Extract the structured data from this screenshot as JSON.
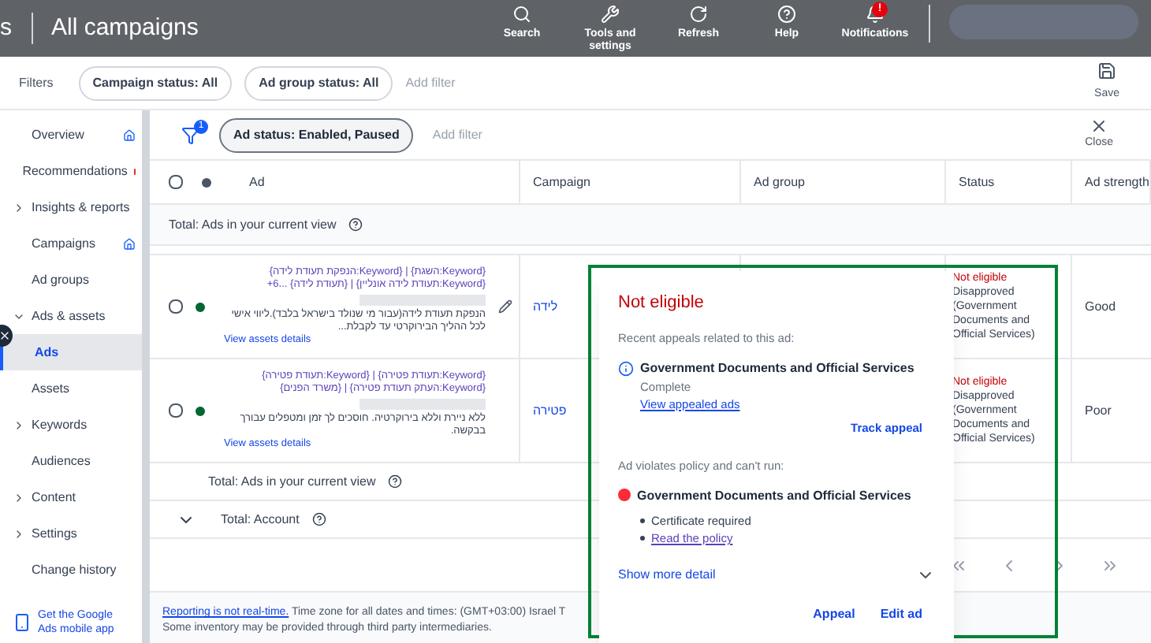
{
  "header": {
    "title_fragment": "s",
    "title": "All campaigns",
    "actions": [
      {
        "kind": "search",
        "label": "Search"
      },
      {
        "kind": "tools",
        "label": "Tools and settings"
      },
      {
        "kind": "refresh",
        "label": "Refresh"
      },
      {
        "kind": "help",
        "label": "Help"
      },
      {
        "kind": "notifications",
        "label": "Notifications",
        "badge": "!"
      }
    ]
  },
  "filters": {
    "label": "Filters",
    "chips": [
      "Campaign status: All",
      "Ad group status: All"
    ],
    "add_filter": "Add filter",
    "save": "Save"
  },
  "sidebar": {
    "items": [
      {
        "label": "Overview",
        "icon": true,
        "selected": false
      },
      {
        "label": "Recommendations",
        "color": "#d93025",
        "selected": false
      },
      {
        "label": "Insights & reports",
        "expanded": false,
        "selected": false
      },
      {
        "label": "Campaigns",
        "icon": true,
        "selected": false
      },
      {
        "label": "Ad groups",
        "selected": false
      },
      {
        "label": "Ads & assets",
        "expanded": true,
        "selected": false,
        "children": [
          {
            "label": "Ads",
            "selected": true
          },
          {
            "label": "Assets",
            "selected": false
          }
        ]
      },
      {
        "label": "Keywords",
        "expanded": false,
        "selected": false
      },
      {
        "label": "Audiences",
        "selected": false
      },
      {
        "label": "Content",
        "expanded": false,
        "selected": false
      },
      {
        "label": "Settings",
        "expanded": false,
        "selected": false
      },
      {
        "label": "Change history",
        "selected": false
      }
    ],
    "app_promo": "Get the Google Ads mobile app"
  },
  "table_filters": {
    "badge": "1",
    "chip": "Ad status: Enabled, Paused",
    "add_filter": "Add filter",
    "close": "Close"
  },
  "table": {
    "select_all_checked": false,
    "columns": [
      "Ad",
      "Campaign",
      "Ad group",
      "Status",
      "Ad strength"
    ],
    "total_top": "Total: Ads in your current view",
    "rows": [
      {
        "headline": "{Keyword:השגת} | {Keyword:הנפקת תעודת לידה} {Keyword:תעודת לידה אונליין} | {תעודת לידה} ...6+",
        "description": "הנפקת תעודת לידה(עבור מי שנולד בישראל בלבד).ליווי אישי לכל ההליך הבירוקרטי עד לקבלת...",
        "link": "View assets details",
        "campaign": "לידה",
        "status": "Not eligible",
        "status_detail": "Disapproved (Government Documents and Official Services)",
        "strength": "Good",
        "editable": true,
        "checked": false
      },
      {
        "headline": "{Keyword:תעודת פטירה} | {Keyword:תעודת פטירה} {Keyword:העתק תעודת פטירה} | {משרד הפנים}",
        "description": "ללא ניירת וללא בירוקרטיה. חוסכים לך זמן ומטפלים עבורך בבקשה.",
        "link": "View assets details",
        "campaign": "פטירה",
        "status": "Not eligible",
        "status_detail": "Disapproved (Government Documents and Official Services)",
        "strength": "Poor",
        "editable": false,
        "checked": false
      }
    ],
    "totals": [
      "Total: Ads in your current view",
      "Total: Account"
    ]
  },
  "popup": {
    "title": "Not eligible",
    "appeals_label": "Recent appeals related to this ad:",
    "appeal_policy": "Government Documents and Official Services",
    "appeal_status": "Complete",
    "view_link": "View appealed ads",
    "track": "Track appeal",
    "violation_label": "Ad violates policy and can't run:",
    "violation_policy": "Government Documents and Official Services",
    "bullets": [
      {
        "kind": "text",
        "text": "Certificate required"
      },
      {
        "kind": "link",
        "text": "Read the policy"
      }
    ],
    "more": "Show more detail",
    "buttons": [
      "Appeal",
      "Edit ad"
    ]
  },
  "footer": {
    "link": "Reporting is not real-time.",
    "text": " Time zone for all dates and times: (GMT+03:00) Israel T",
    "line2": "Some inventory may be provided through third party intermediaries."
  }
}
